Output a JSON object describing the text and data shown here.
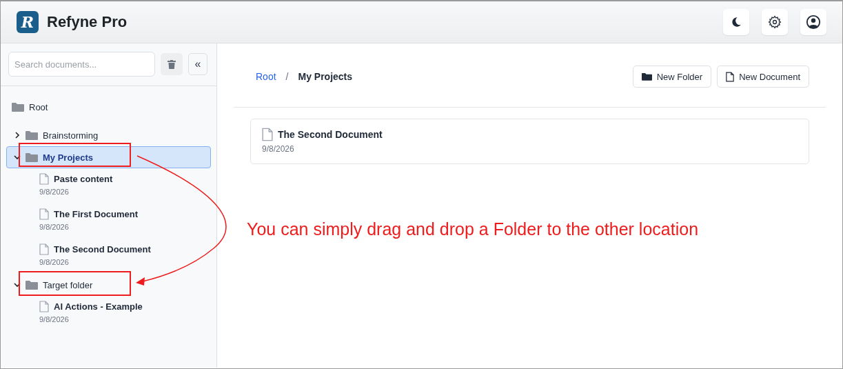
{
  "app": {
    "title": "Refyne Pro",
    "logo_letter": "R"
  },
  "sidebar": {
    "search": {
      "placeholder": "Search documents..."
    },
    "collapse_label": "«",
    "root": {
      "label": "Root"
    },
    "tree": [
      {
        "kind": "folder",
        "label": "Brainstorming",
        "expanded": false,
        "selected": false
      },
      {
        "kind": "folder",
        "label": "My Projects",
        "expanded": true,
        "selected": true,
        "children": [
          {
            "label": "Paste content",
            "date": "9/8/2026"
          },
          {
            "label": "The First Document",
            "date": "9/8/2026"
          },
          {
            "label": "The Second Document",
            "date": "9/8/2026"
          }
        ]
      },
      {
        "kind": "folder",
        "label": "Target folder",
        "expanded": true,
        "selected": false,
        "children": [
          {
            "label": "AI Actions - Example",
            "date": "9/8/2026"
          }
        ]
      }
    ]
  },
  "breadcrumb": [
    {
      "label": "Root",
      "selected": false
    },
    {
      "label": "My Projects",
      "selected": true
    }
  ],
  "breadcrumb_separator": "/",
  "buttons": [
    {
      "kind": "folder",
      "label": "New Folder"
    },
    {
      "kind": "document",
      "label": "New Document"
    }
  ],
  "documents": [
    {
      "label": "The Second Document",
      "date": "9/8/2026"
    }
  ],
  "annotation": {
    "text": "You can simply drag and drop a Folder to the other location"
  }
}
